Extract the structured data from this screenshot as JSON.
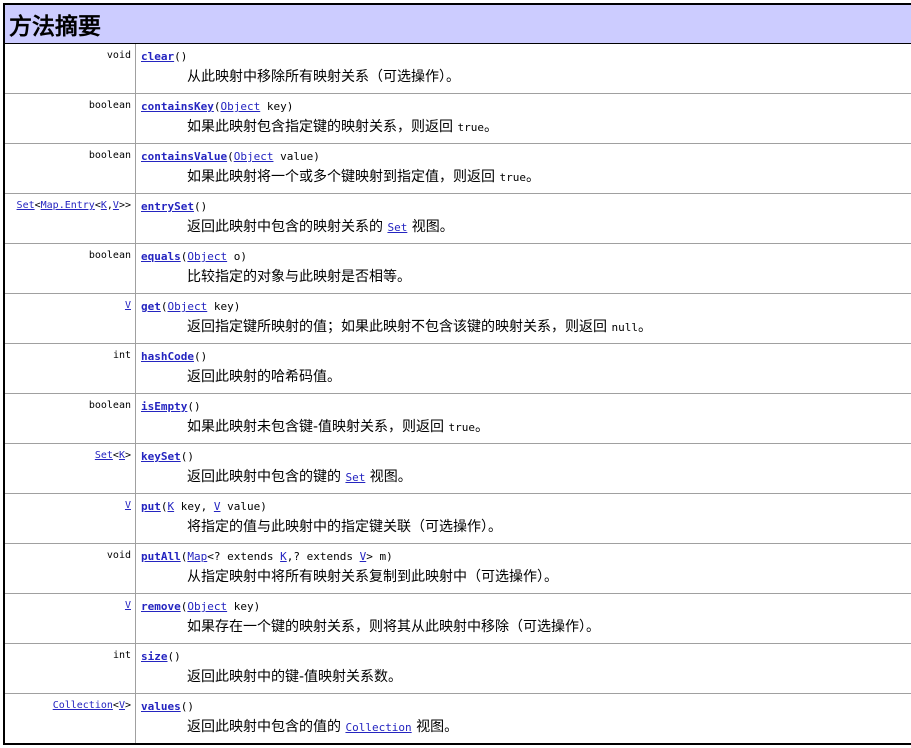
{
  "header": {
    "title": "方法摘要"
  },
  "colors": {
    "header_bg": "#ccccff",
    "link": "#2424c0",
    "border": "#000000"
  },
  "rows": [
    {
      "type_parts": [
        {
          "t": "void",
          "link": false
        }
      ],
      "method": "clear",
      "sig_parts": [
        {
          "t": "()",
          "link": false
        }
      ],
      "desc_parts": [
        {
          "t": "从此映射中移除所有映射关系（可选操作）。",
          "kind": "text"
        }
      ]
    },
    {
      "type_parts": [
        {
          "t": "boolean",
          "link": false
        }
      ],
      "method": "containsKey",
      "sig_parts": [
        {
          "t": "(",
          "link": false
        },
        {
          "t": "Object",
          "link": true
        },
        {
          "t": "  key)",
          "link": false
        }
      ],
      "desc_parts": [
        {
          "t": "如果此映射包含指定键的映射关系，则返回 ",
          "kind": "text"
        },
        {
          "t": "true",
          "kind": "mono"
        },
        {
          "t": "。",
          "kind": "text"
        }
      ]
    },
    {
      "type_parts": [
        {
          "t": "boolean",
          "link": false
        }
      ],
      "method": "containsValue",
      "sig_parts": [
        {
          "t": "(",
          "link": false
        },
        {
          "t": "Object",
          "link": true
        },
        {
          "t": "  value)",
          "link": false
        }
      ],
      "desc_parts": [
        {
          "t": "如果此映射将一个或多个键映射到指定值，则返回 ",
          "kind": "text"
        },
        {
          "t": "true",
          "kind": "mono"
        },
        {
          "t": "。",
          "kind": "text"
        }
      ]
    },
    {
      "type_parts": [
        {
          "t": "Set",
          "link": true
        },
        {
          "t": "<",
          "link": false
        },
        {
          "t": "Map.Entry",
          "link": true
        },
        {
          "t": "<",
          "link": false
        },
        {
          "t": "K",
          "link": true
        },
        {
          "t": ",",
          "link": false
        },
        {
          "t": "V",
          "link": true
        },
        {
          "t": ">>",
          "link": false
        }
      ],
      "method": "entrySet",
      "sig_parts": [
        {
          "t": "()",
          "link": false
        }
      ],
      "desc_parts": [
        {
          "t": "返回此映射中包含的映射关系的 ",
          "kind": "text"
        },
        {
          "t": "Set",
          "kind": "link"
        },
        {
          "t": " 视图。",
          "kind": "text"
        }
      ]
    },
    {
      "type_parts": [
        {
          "t": "boolean",
          "link": false
        }
      ],
      "method": "equals",
      "sig_parts": [
        {
          "t": "(",
          "link": false
        },
        {
          "t": "Object",
          "link": true
        },
        {
          "t": "  o)",
          "link": false
        }
      ],
      "desc_parts": [
        {
          "t": "比较指定的对象与此映射是否相等。",
          "kind": "text"
        }
      ]
    },
    {
      "type_parts": [
        {
          "t": "V",
          "link": true
        }
      ],
      "method": "get",
      "sig_parts": [
        {
          "t": "(",
          "link": false
        },
        {
          "t": "Object",
          "link": true
        },
        {
          "t": "  key)",
          "link": false
        }
      ],
      "desc_parts": [
        {
          "t": "返回指定键所映射的值；如果此映射不包含该键的映射关系，则返回 ",
          "kind": "text"
        },
        {
          "t": "null",
          "kind": "mono"
        },
        {
          "t": "。",
          "kind": "text"
        }
      ]
    },
    {
      "type_parts": [
        {
          "t": "int",
          "link": false
        }
      ],
      "method": "hashCode",
      "sig_parts": [
        {
          "t": "()",
          "link": false
        }
      ],
      "desc_parts": [
        {
          "t": "返回此映射的哈希码值。",
          "kind": "text"
        }
      ]
    },
    {
      "type_parts": [
        {
          "t": "boolean",
          "link": false
        }
      ],
      "method": "isEmpty",
      "sig_parts": [
        {
          "t": "()",
          "link": false
        }
      ],
      "desc_parts": [
        {
          "t": "如果此映射未包含键-值映射关系，则返回 ",
          "kind": "text"
        },
        {
          "t": "true",
          "kind": "mono"
        },
        {
          "t": "。",
          "kind": "text"
        }
      ]
    },
    {
      "type_parts": [
        {
          "t": "Set",
          "link": true
        },
        {
          "t": "<",
          "link": false
        },
        {
          "t": "K",
          "link": true
        },
        {
          "t": ">",
          "link": false
        }
      ],
      "method": "keySet",
      "sig_parts": [
        {
          "t": "()",
          "link": false
        }
      ],
      "desc_parts": [
        {
          "t": "返回此映射中包含的键的 ",
          "kind": "text"
        },
        {
          "t": "Set",
          "kind": "link"
        },
        {
          "t": " 视图。",
          "kind": "text"
        }
      ]
    },
    {
      "type_parts": [
        {
          "t": "V",
          "link": true
        }
      ],
      "method": "put",
      "sig_parts": [
        {
          "t": "(",
          "link": false
        },
        {
          "t": "K",
          "link": true
        },
        {
          "t": "  key, ",
          "link": false
        },
        {
          "t": "V",
          "link": true
        },
        {
          "t": "  value)",
          "link": false
        }
      ],
      "desc_parts": [
        {
          "t": "将指定的值与此映射中的指定键关联（可选操作）。",
          "kind": "text"
        }
      ]
    },
    {
      "type_parts": [
        {
          "t": "void",
          "link": false
        }
      ],
      "method": "putAll",
      "sig_parts": [
        {
          "t": "(",
          "link": false
        },
        {
          "t": "Map",
          "link": true
        },
        {
          "t": "<? extends ",
          "link": false
        },
        {
          "t": "K",
          "link": true
        },
        {
          "t": ",? extends ",
          "link": false
        },
        {
          "t": "V",
          "link": true
        },
        {
          "t": ">  m)",
          "link": false
        }
      ],
      "desc_parts": [
        {
          "t": "从指定映射中将所有映射关系复制到此映射中（可选操作）。",
          "kind": "text"
        }
      ]
    },
    {
      "type_parts": [
        {
          "t": "V",
          "link": true
        }
      ],
      "method": "remove",
      "sig_parts": [
        {
          "t": "(",
          "link": false
        },
        {
          "t": "Object",
          "link": true
        },
        {
          "t": "  key)",
          "link": false
        }
      ],
      "desc_parts": [
        {
          "t": "如果存在一个键的映射关系，则将其从此映射中移除（可选操作）。",
          "kind": "text"
        }
      ]
    },
    {
      "type_parts": [
        {
          "t": "int",
          "link": false
        }
      ],
      "method": "size",
      "sig_parts": [
        {
          "t": "()",
          "link": false
        }
      ],
      "desc_parts": [
        {
          "t": "返回此映射中的键-值映射关系数。",
          "kind": "text"
        }
      ]
    },
    {
      "type_parts": [
        {
          "t": "Collection",
          "link": true
        },
        {
          "t": "<",
          "link": false
        },
        {
          "t": "V",
          "link": true
        },
        {
          "t": ">",
          "link": false
        }
      ],
      "method": "values",
      "sig_parts": [
        {
          "t": "()",
          "link": false
        }
      ],
      "desc_parts": [
        {
          "t": "返回此映射中包含的值的 ",
          "kind": "text"
        },
        {
          "t": "Collection",
          "kind": "link"
        },
        {
          "t": " 视图。",
          "kind": "text"
        }
      ]
    }
  ]
}
